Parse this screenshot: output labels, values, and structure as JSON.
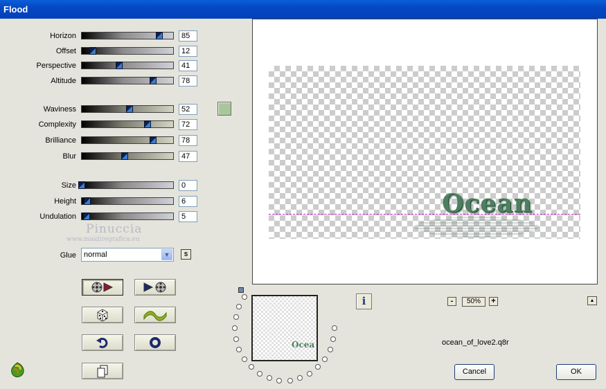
{
  "window": {
    "title": "Flood"
  },
  "sliders_group1": [
    {
      "label": "Horizon",
      "value": "85",
      "fraction": 0.85
    },
    {
      "label": "Offset",
      "value": "12",
      "fraction": 0.12
    },
    {
      "label": "Perspective",
      "value": "41",
      "fraction": 0.41
    },
    {
      "label": "Altitude",
      "value": "78",
      "fraction": 0.78
    }
  ],
  "sliders_group2": [
    {
      "label": "Waviness",
      "value": "52",
      "fraction": 0.52
    },
    {
      "label": "Complexity",
      "value": "72",
      "fraction": 0.72
    },
    {
      "label": "Brilliance",
      "value": "78",
      "fraction": 0.78
    },
    {
      "label": "Blur",
      "value": "47",
      "fraction": 0.47
    }
  ],
  "sliders_group3": [
    {
      "label": "Size",
      "value": "0",
      "fraction": 0.0
    },
    {
      "label": "Height",
      "value": "6",
      "fraction": 0.06
    },
    {
      "label": "Undulation",
      "value": "5",
      "fraction": 0.05
    }
  ],
  "color_swatch": "#a8c89c",
  "watermark": {
    "line1": "Pinuccia",
    "line2": "www.maidiregrafica.eu"
  },
  "glue": {
    "label": "Glue",
    "value": "normal"
  },
  "small_s_button": "S",
  "preview": {
    "word": "Ocean"
  },
  "navigator": {
    "word": "Ocea"
  },
  "info_icon": "i",
  "zoom": {
    "value": "50%",
    "minus": "-",
    "plus": "+"
  },
  "up_arrow": "▲",
  "filename": "ocean_of_love2.q8r",
  "buttons": {
    "cancel": "Cancel",
    "ok": "OK"
  },
  "colors": {
    "title_bar": "#0548c4",
    "ocean_text": "#4d8060"
  }
}
